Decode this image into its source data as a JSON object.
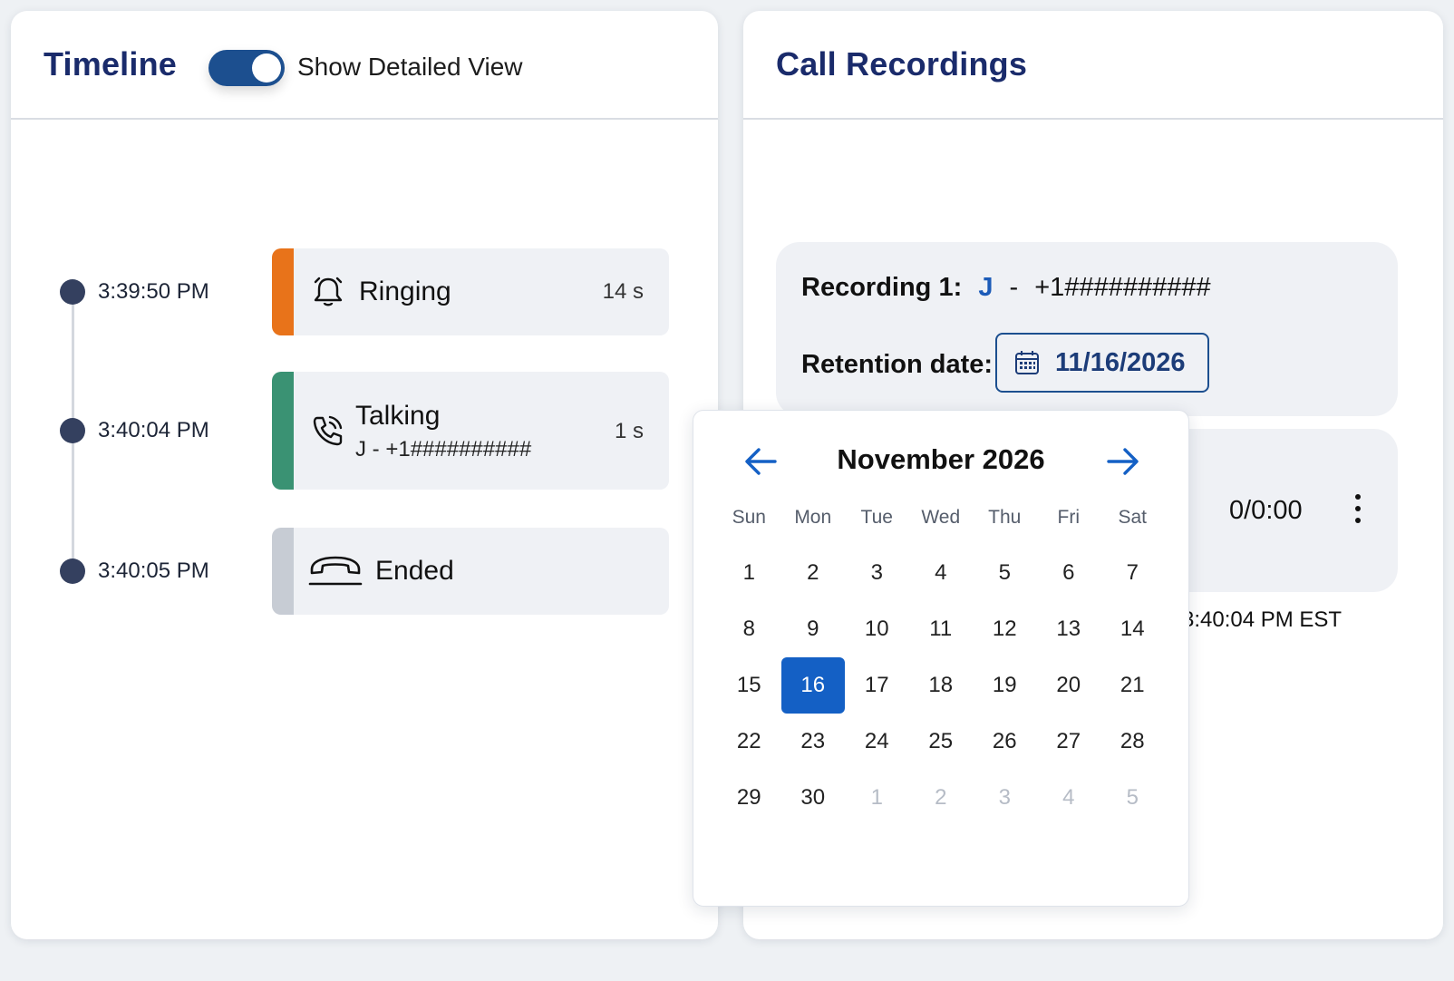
{
  "timeline": {
    "title": "Timeline",
    "toggle_label": "Show Detailed View",
    "toggle_on": true,
    "events": [
      {
        "time": "3:39:50 PM",
        "label": "Ringing",
        "sub": "",
        "duration": "14 s",
        "color": "#e8731a",
        "icon": "bell-icon"
      },
      {
        "time": "3:40:04 PM",
        "label": "Talking",
        "sub": "J - +1##########",
        "duration": "1 s",
        "color": "#3a9273",
        "icon": "phone-call-icon"
      },
      {
        "time": "3:40:05 PM",
        "label": "Ended",
        "sub": "",
        "duration": "",
        "color": "#c7ccd4",
        "icon": "hang-up-icon"
      }
    ]
  },
  "recordings": {
    "title": "Call Recordings",
    "items": [
      {
        "prefix": "Recording 1:",
        "name": "J",
        "sep": "-",
        "phone": "+1##########",
        "retention_label": "Retention date:",
        "retention_date": "11/16/2026",
        "player_time": "0/0:00",
        "footer": "3:40:04 PM EST"
      }
    ]
  },
  "calendar": {
    "month_label": "November 2026",
    "weekdays": [
      "Sun",
      "Mon",
      "Tue",
      "Wed",
      "Thu",
      "Fri",
      "Sat"
    ],
    "days": [
      {
        "d": "1"
      },
      {
        "d": "2"
      },
      {
        "d": "3"
      },
      {
        "d": "4"
      },
      {
        "d": "5"
      },
      {
        "d": "6"
      },
      {
        "d": "7"
      },
      {
        "d": "8"
      },
      {
        "d": "9"
      },
      {
        "d": "10"
      },
      {
        "d": "11"
      },
      {
        "d": "12"
      },
      {
        "d": "13"
      },
      {
        "d": "14"
      },
      {
        "d": "15"
      },
      {
        "d": "16",
        "selected": true
      },
      {
        "d": "17"
      },
      {
        "d": "18"
      },
      {
        "d": "19"
      },
      {
        "d": "20"
      },
      {
        "d": "21"
      },
      {
        "d": "22"
      },
      {
        "d": "23"
      },
      {
        "d": "24"
      },
      {
        "d": "25"
      },
      {
        "d": "26"
      },
      {
        "d": "27"
      },
      {
        "d": "28"
      },
      {
        "d": "29"
      },
      {
        "d": "30"
      },
      {
        "d": "1",
        "other": true
      },
      {
        "d": "2",
        "other": true
      },
      {
        "d": "3",
        "other": true
      },
      {
        "d": "4",
        "other": true
      },
      {
        "d": "5",
        "other": true
      }
    ],
    "accent_color": "#1460c5"
  }
}
